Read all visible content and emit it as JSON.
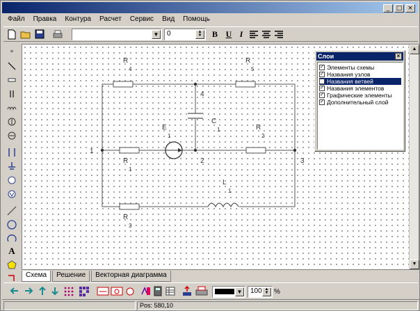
{
  "menu": [
    "Файл",
    "Правка",
    "Контура",
    "Расчет",
    "Сервис",
    "Вид",
    "Помощь"
  ],
  "toolbar": {
    "font_size_value": "0",
    "bold": "B",
    "underline": "U",
    "italic": "I"
  },
  "title_buttons": [
    "_",
    "□",
    "×"
  ],
  "layers": {
    "title": "Слои",
    "items": [
      {
        "label": "Элементы схемы",
        "checked": true
      },
      {
        "label": "Названия узлов",
        "checked": true
      },
      {
        "label": "Названия ветвей",
        "checked": false,
        "selected": true
      },
      {
        "label": "Названия элементов",
        "checked": true
      },
      {
        "label": "Графические элементы",
        "checked": true
      },
      {
        "label": "Дополнительный слой",
        "checked": true
      }
    ]
  },
  "circuit": {
    "node_labels": [
      "1",
      "2",
      "3",
      "4"
    ],
    "elements": [
      {
        "name": "R",
        "index": "4"
      },
      {
        "name": "R",
        "index": "5"
      },
      {
        "name": "C",
        "index": "1"
      },
      {
        "name": "E",
        "index": "1"
      },
      {
        "name": "R",
        "index": "1"
      },
      {
        "name": "R",
        "index": "2"
      },
      {
        "name": "L",
        "index": "1"
      },
      {
        "name": "R",
        "index": "3"
      }
    ]
  },
  "tabs": [
    "Схема",
    "Решение",
    "Векторная диаграмма"
  ],
  "bottom_toolbar": {
    "zoom_value": "100",
    "zoom_unit": "%"
  },
  "status": {
    "pos": "Pos: 580,10"
  }
}
